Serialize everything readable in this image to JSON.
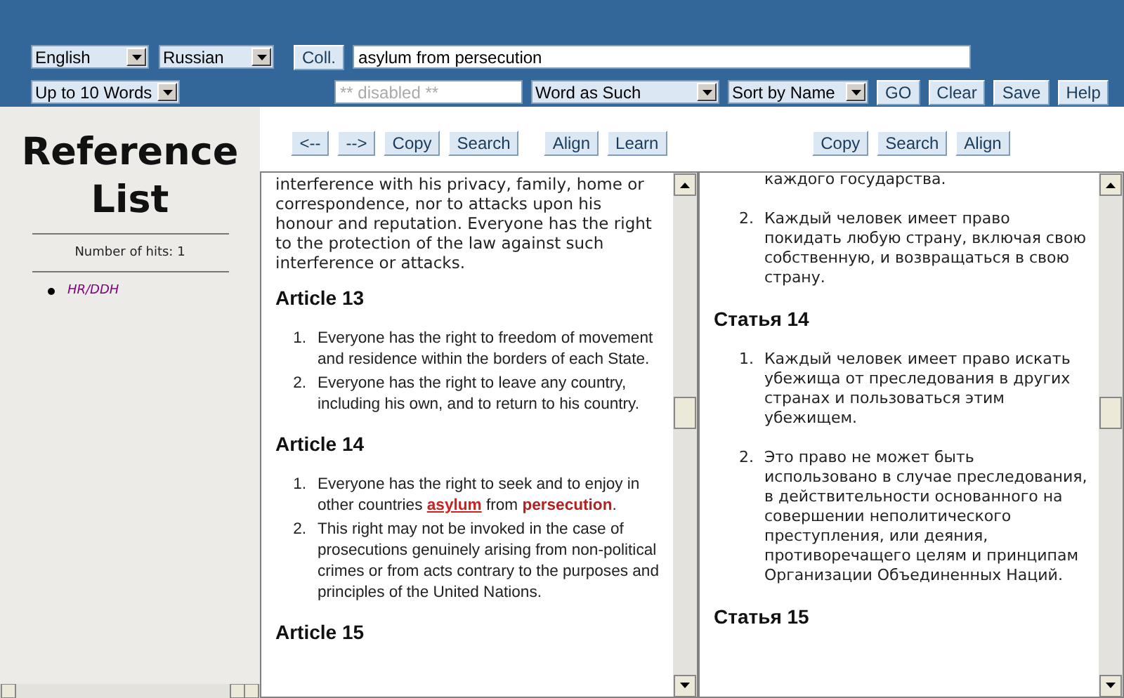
{
  "toolbar": {
    "source_language": "English",
    "target_language": "Russian",
    "coll_button": "Coll.",
    "query": "asylum from persecution",
    "word_limit": "Up to 10 Words",
    "disabled_field": {
      "placeholder": "** disabled **"
    },
    "match_mode": "Word as Such",
    "sort": "Sort by Name",
    "buttons": [
      "GO",
      "Clear",
      "Save",
      "Help"
    ]
  },
  "sidebar": {
    "title": "Reference List",
    "hits": "Number of hits: 1",
    "references": [
      "HR/DDH"
    ]
  },
  "source_pane": {
    "button_groups": [
      [
        "<--",
        "-->",
        "Copy",
        "Search"
      ],
      [
        "Align",
        "Learn"
      ]
    ],
    "content": [
      {
        "kind": "paragraph",
        "text": "interference with his privacy, family, home or correspondence, nor to attacks upon his honour and reputation. Everyone has the right to the protection of the law against such interference or attacks."
      },
      {
        "kind": "heading",
        "text": "Article 13"
      },
      {
        "kind": "list",
        "items": [
          {
            "number": "1.",
            "text": "Everyone has the right to freedom of movement and residence within the borders of each State."
          },
          {
            "number": "2.",
            "text": "Everyone has the right to leave any country, including his own, and to return to his country."
          }
        ]
      },
      {
        "kind": "heading",
        "text": "Article 14"
      },
      {
        "kind": "list",
        "items": [
          {
            "number": "1.",
            "text": "Everyone has the right to seek and to enjoy in other countries **asylum** from **persecution**."
          },
          {
            "number": "2.",
            "text": "This right may not be invoked in the case of prosecutions genuinely arising from non-political crimes or from acts contrary to the purposes and principles of the United Nations."
          }
        ]
      },
      {
        "kind": "heading",
        "text": "Article 15"
      }
    ]
  },
  "target_pane": {
    "button_groups": [
      [
        "Copy",
        "Search",
        "Align"
      ]
    ],
    "content": [
      {
        "kind": "continuation",
        "text": "каждого государства."
      },
      {
        "kind": "list",
        "items": [
          {
            "number": "2.",
            "text": "Каждый человек имеет право покидать любую страну, включая свою собственную, и возвращаться в свою страну."
          }
        ]
      },
      {
        "kind": "heading",
        "text": "Статья 14"
      },
      {
        "kind": "list",
        "items": [
          {
            "number": "1.",
            "text": "Каждый человек имеет право искать убежища от преследования в других странах и пользоваться этим убежищем."
          },
          {
            "number": "2.",
            "text": "Это право не может быть использовано в случае преследования, в действительности основанного на совершении неполитического преступления, или деяния, противоречащего целям и принципам Организации Объединенных Наций."
          }
        ]
      },
      {
        "kind": "heading",
        "text": "Статья 15"
      }
    ]
  }
}
